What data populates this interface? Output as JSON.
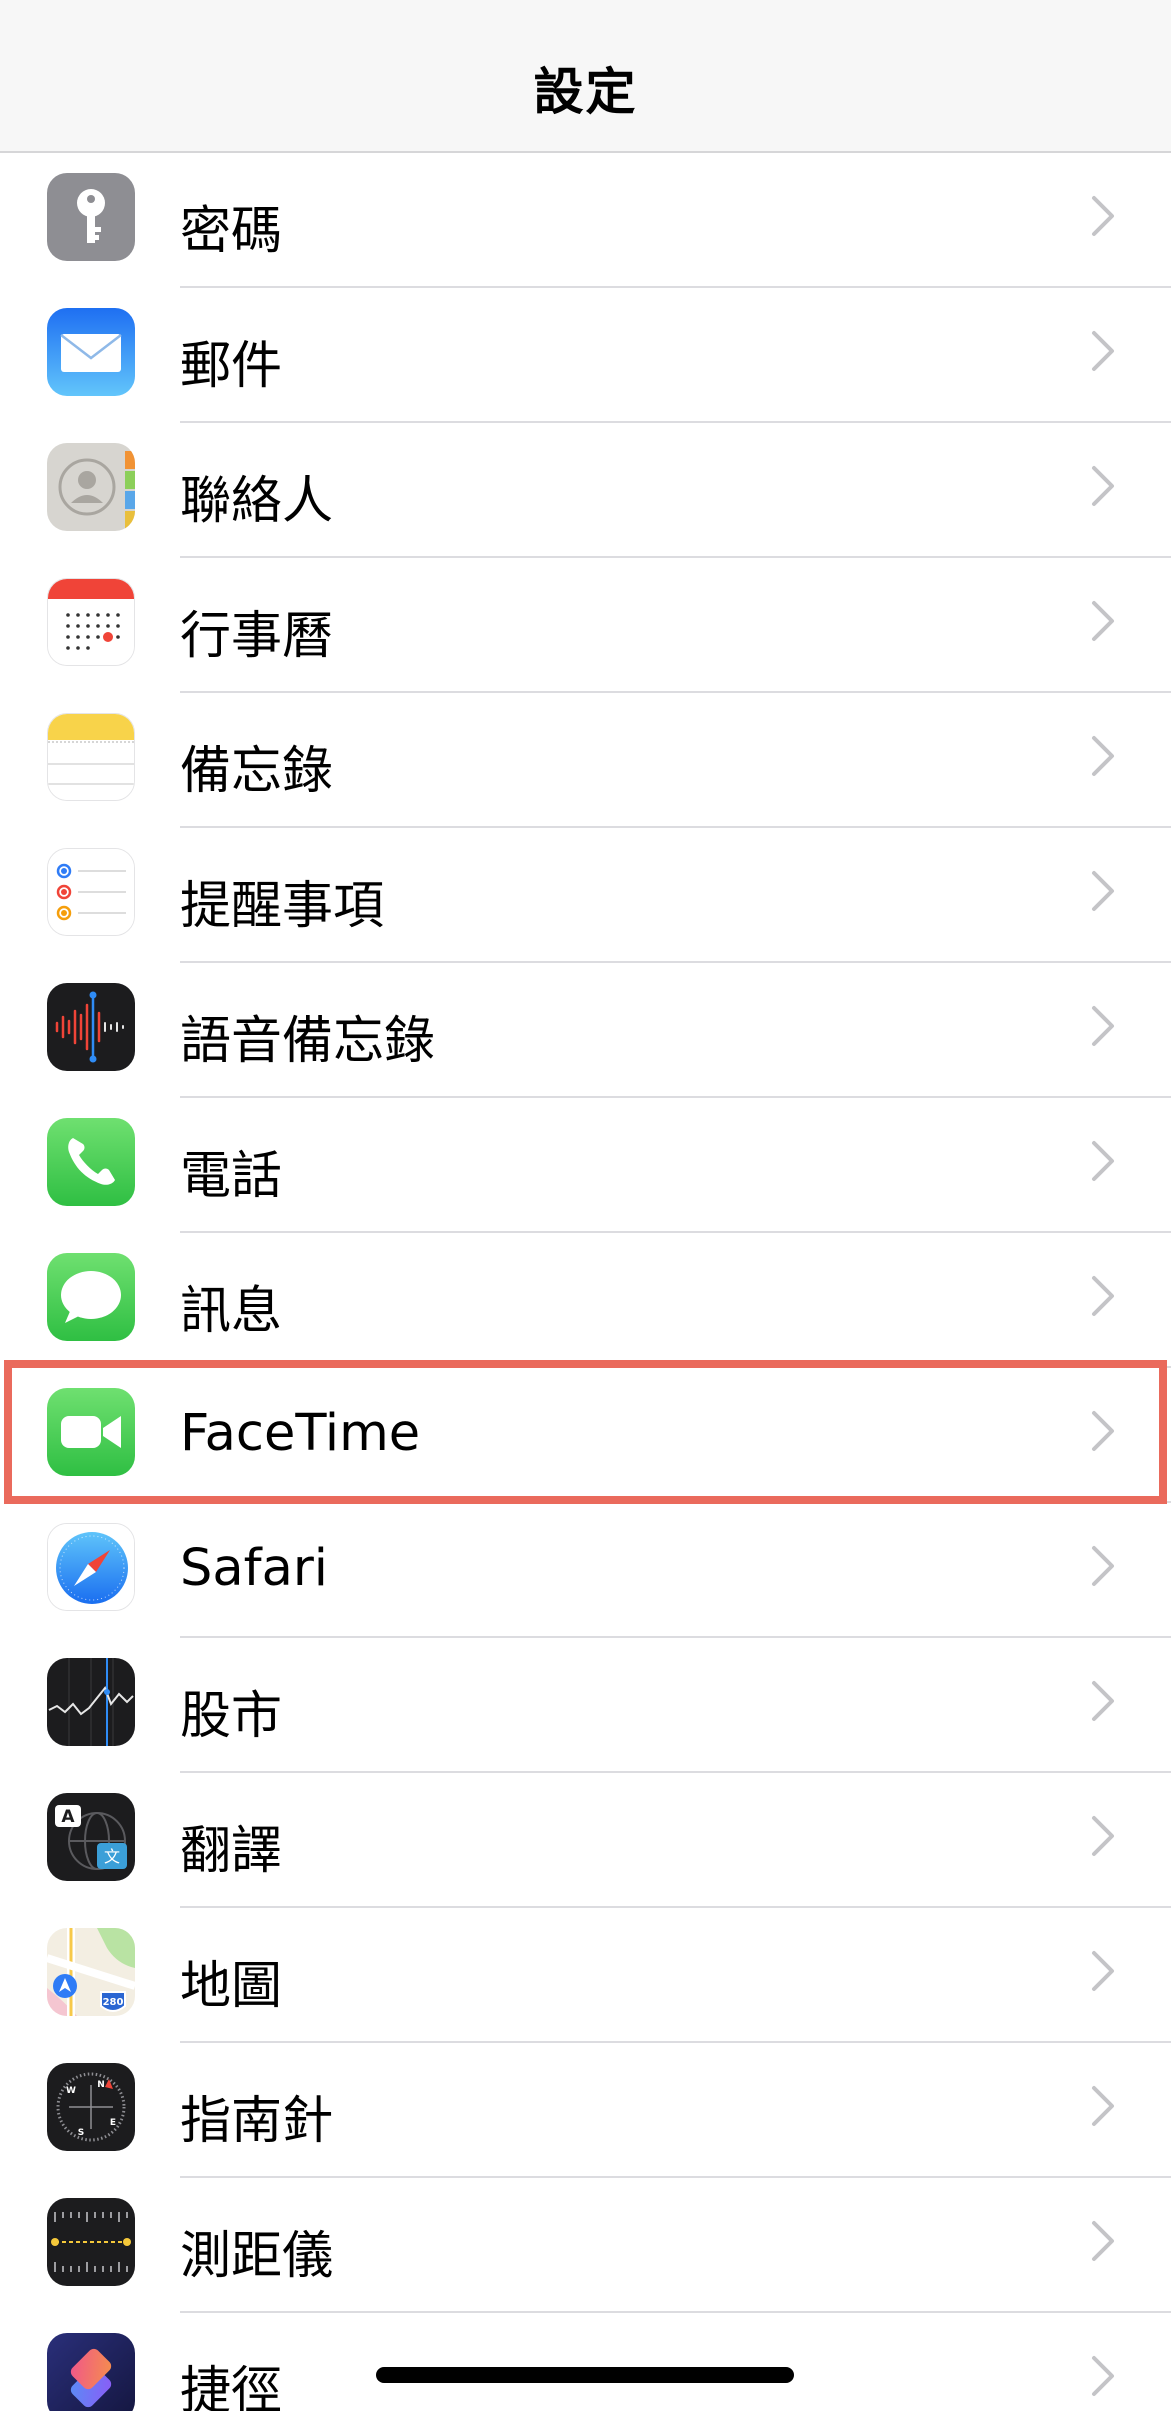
{
  "nav": {
    "title": "設定"
  },
  "rows": [
    {
      "label": "密碼",
      "icon": "key-icon"
    },
    {
      "label": "郵件",
      "icon": "mail-icon"
    },
    {
      "label": "聯絡人",
      "icon": "contacts-icon"
    },
    {
      "label": "行事曆",
      "icon": "calendar-icon"
    },
    {
      "label": "備忘錄",
      "icon": "notes-icon"
    },
    {
      "label": "提醒事項",
      "icon": "reminders-icon"
    },
    {
      "label": "語音備忘錄",
      "icon": "voice-memos-icon"
    },
    {
      "label": "電話",
      "icon": "phone-icon"
    },
    {
      "label": "訊息",
      "icon": "messages-icon"
    },
    {
      "label": "FaceTime",
      "icon": "facetime-icon"
    },
    {
      "label": "Safari",
      "icon": "safari-icon"
    },
    {
      "label": "股市",
      "icon": "stocks-icon"
    },
    {
      "label": "翻譯",
      "icon": "translate-icon"
    },
    {
      "label": "地圖",
      "icon": "maps-icon"
    },
    {
      "label": "指南針",
      "icon": "compass-icon"
    },
    {
      "label": "測距儀",
      "icon": "measure-icon"
    },
    {
      "label": "捷徑",
      "icon": "shortcuts-icon"
    }
  ],
  "highlighted": "FaceTime",
  "icon_text": {
    "translate_a": "A",
    "translate_b": "文",
    "maps_shield": "280",
    "compass_n": "N",
    "compass_s": "S",
    "compass_e": "E",
    "compass_w": "W"
  },
  "colors": {
    "highlight": "#ea6a5c",
    "chevron": "#c4c4c7",
    "separator": "#dcdce0"
  }
}
